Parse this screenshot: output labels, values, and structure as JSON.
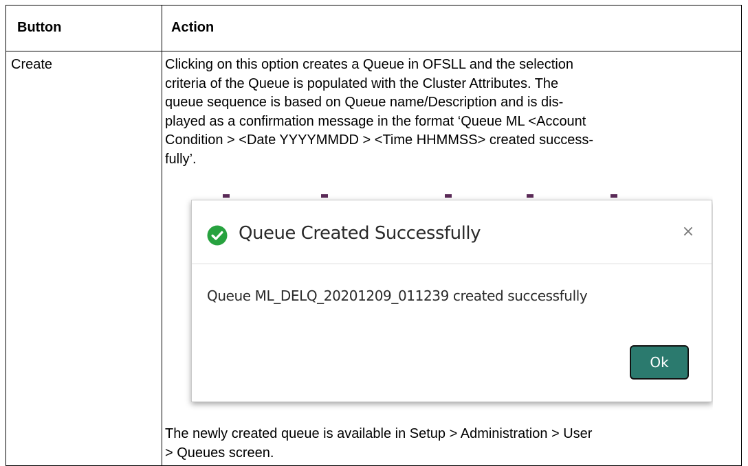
{
  "table": {
    "header": {
      "col1": "Button",
      "col2": "Action"
    },
    "row": {
      "button": "Create",
      "description_lines": [
        "Clicking on this option creates a Queue in OFSLL and the selection",
        "criteria of the Queue is populated with the Cluster Attributes. The",
        "queue sequence is based on Queue name/Description and is dis-",
        "played as a confirmation message in the format ‘Queue ML <Account",
        "Condition > <Date YYYYMMDD > <Time HHMMSS> created success-",
        "fully’."
      ],
      "footer_lines": [
        "The newly created queue is available in Setup > Administration > User",
        "> Queues screen."
      ]
    }
  },
  "dialog": {
    "title": "Queue Created Successfully",
    "close_glyph": "×",
    "message": "Queue ML_DELQ_20201209_011239 created successfully",
    "ok_label": "Ok",
    "icon": "check-circle-icon",
    "colors": {
      "success": "#27a23f",
      "ok_button": "#2b7a6e",
      "backdrop_marks": "#5b2b58"
    }
  }
}
